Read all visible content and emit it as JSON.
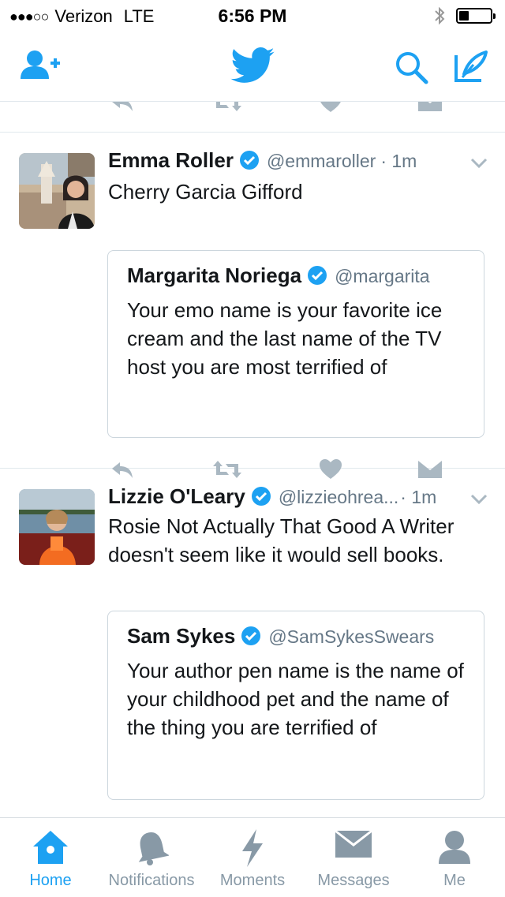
{
  "status_bar": {
    "carrier": "Verizon",
    "network": "LTE",
    "time": "6:56 PM",
    "signal_dots": "●●●○○"
  },
  "nav": {
    "icons": [
      "add-user-icon",
      "twitter-bird-icon",
      "search-icon",
      "compose-icon"
    ]
  },
  "colors": {
    "brand_blue": "#1da1f2",
    "icon_gray": "#aab8c2",
    "text_secondary": "#657786"
  },
  "tweets": [
    {
      "name": "Emma Roller",
      "handle": "@emmaroller",
      "time": "· 1m",
      "text": "Cherry Garcia Gifford",
      "quote": {
        "name": "Margarita Noriega",
        "handle": "@margarita",
        "text": "Your emo name is your favorite ice cream and the last name of the TV host you are most terrified of"
      }
    },
    {
      "name": "Lizzie O'Leary",
      "handle": "@lizzieohrea...",
      "time": "· 1m",
      "text": "Rosie Not Actually That Good A Writer doesn't seem like it would sell books.",
      "quote": {
        "name": "Sam Sykes",
        "handle": "@SamSykesSwears",
        "text": "Your author pen name is the name of your childhood pet and the name of the thing you are terrified of"
      }
    }
  ],
  "tabs": [
    {
      "label": "Home",
      "icon": "home-icon",
      "active": true
    },
    {
      "label": "Notifications",
      "icon": "bell-icon",
      "active": false
    },
    {
      "label": "Moments",
      "icon": "lightning-icon",
      "active": false
    },
    {
      "label": "Messages",
      "icon": "envelope-icon",
      "active": false
    },
    {
      "label": "Me",
      "icon": "person-icon",
      "active": false
    }
  ]
}
